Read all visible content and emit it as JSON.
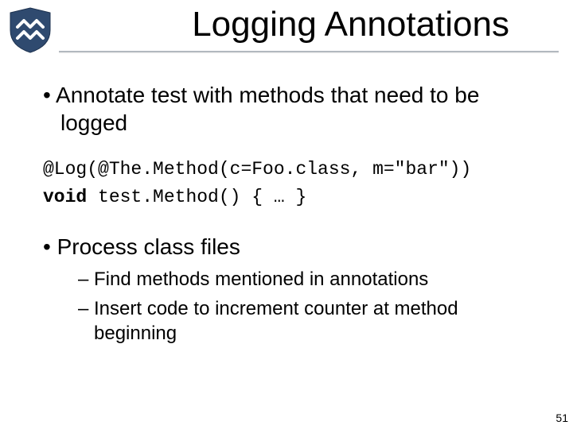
{
  "header": {
    "title": "Logging Annotations"
  },
  "bullets": {
    "b1": "Annotate test with methods that need to be logged",
    "codeLine1": "@Log(@The.Method(c=Foo.class, m=\"bar\"))",
    "codeKw": "void",
    "codeLine2Rest": " test.Method() { … }",
    "b2": "Process class files",
    "s1": "Find methods mentioned in annotations",
    "s2": "Insert code to increment counter at method beginning"
  },
  "page": {
    "number": "51"
  }
}
